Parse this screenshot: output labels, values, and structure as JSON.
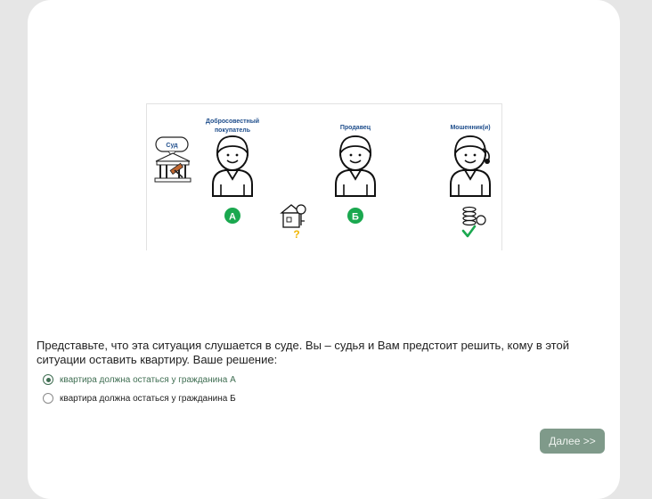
{
  "illustration": {
    "court_label": "Суд",
    "buyer_label_line1": "Добросовестный",
    "buyer_label_line2": "покупатель",
    "seller_label": "Продавец",
    "fraud_label": "Мошенник(и)",
    "badge_a": "А",
    "badge_b": "Б",
    "badge_color": "#1aa84f"
  },
  "question": {
    "text": "Представьте, что эта ситуация слушается в суде. Вы – судья и Вам предстоит решить, кому в этой ситуации оставить квартиру. Ваше решение:"
  },
  "options": [
    {
      "label": "квартира должна остаться у гражданина А",
      "selected": true
    },
    {
      "label": "квартира должна остаться у гражданина Б",
      "selected": false
    }
  ],
  "next_button": {
    "label": "Далее >>"
  },
  "colors": {
    "accent": "#3f6e52",
    "button": "#7f9a8a",
    "background": "#e6e6e6"
  }
}
